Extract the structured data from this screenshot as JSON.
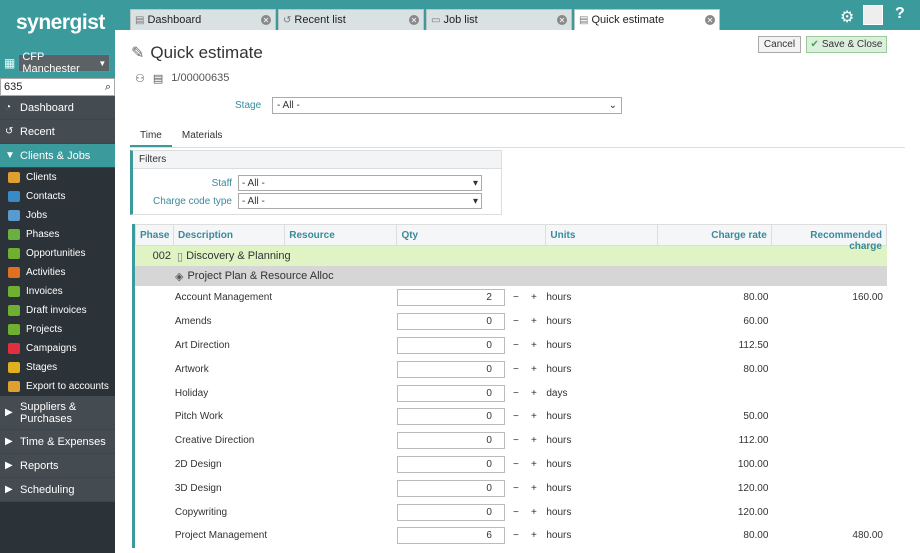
{
  "app": {
    "logo": "synergist",
    "company": "CFP Manchester",
    "search_value": "635"
  },
  "nav": {
    "main": [
      {
        "label": "Dashboard",
        "icon": "dashboard-icon"
      },
      {
        "label": "Recent",
        "icon": "recent-icon"
      },
      {
        "label": "Clients & Jobs",
        "icon": "expand-icon"
      }
    ],
    "sub": [
      {
        "label": "Clients",
        "color": "#e0a030"
      },
      {
        "label": "Contacts",
        "color": "#3a8ac8"
      },
      {
        "label": "Jobs",
        "color": "#5a9ad0"
      },
      {
        "label": "Phases",
        "color": "#6ab040"
      },
      {
        "label": "Opportunities",
        "color": "#70b030"
      },
      {
        "label": "Activities",
        "color": "#e07020"
      },
      {
        "label": "Invoices",
        "color": "#70b030"
      },
      {
        "label": "Draft invoices",
        "color": "#70b030"
      },
      {
        "label": "Projects",
        "color": "#70b030"
      },
      {
        "label": "Campaigns",
        "color": "#e03040"
      },
      {
        "label": "Stages",
        "color": "#e0b020"
      },
      {
        "label": "Export to accounts",
        "color": "#e0a030"
      }
    ],
    "bottom": [
      {
        "label": "Suppliers & Purchases"
      },
      {
        "label": "Time & Expenses"
      },
      {
        "label": "Reports"
      },
      {
        "label": "Scheduling"
      }
    ]
  },
  "tabs": [
    {
      "label": "Dashboard"
    },
    {
      "label": "Recent list"
    },
    {
      "label": "Job list"
    },
    {
      "label": "Quick estimate"
    }
  ],
  "page": {
    "title": "Quick estimate",
    "job_number": "1/00000635",
    "cancel": "Cancel",
    "save_close": "Save & Close",
    "stage_label": "Stage",
    "stage_value": "- All -"
  },
  "subtabs": [
    "Time",
    "Materials"
  ],
  "filters": {
    "title": "Filters",
    "staff_label": "Staff",
    "staff_value": "- All -",
    "charge_label": "Charge code type",
    "charge_value": "- All -"
  },
  "grid": {
    "headers": [
      "Phase",
      "Description",
      "Resource",
      "Qty",
      "Units",
      "Charge rate",
      "Recommended charge"
    ],
    "phase_code": "002",
    "phase_name": "Discovery & Planning",
    "subphase": "Project Plan & Resource Alloc",
    "rows": [
      {
        "desc": "Account Management",
        "qty": "2",
        "units": "hours",
        "rate": "80.00",
        "charge": "160.00"
      },
      {
        "desc": "Amends",
        "qty": "0",
        "units": "hours",
        "rate": "60.00",
        "charge": ""
      },
      {
        "desc": "Art Direction",
        "qty": "0",
        "units": "hours",
        "rate": "112.50",
        "charge": ""
      },
      {
        "desc": "Artwork",
        "qty": "0",
        "units": "hours",
        "rate": "80.00",
        "charge": ""
      },
      {
        "desc": "Holiday",
        "qty": "0",
        "units": "days",
        "rate": "",
        "charge": ""
      },
      {
        "desc": "Pitch Work",
        "qty": "0",
        "units": "hours",
        "rate": "50.00",
        "charge": ""
      },
      {
        "desc": "Creative Direction",
        "qty": "0",
        "units": "hours",
        "rate": "112.00",
        "charge": ""
      },
      {
        "desc": "2D Design",
        "qty": "0",
        "units": "hours",
        "rate": "100.00",
        "charge": ""
      },
      {
        "desc": "3D Design",
        "qty": "0",
        "units": "hours",
        "rate": "120.00",
        "charge": ""
      },
      {
        "desc": "Copywriting",
        "qty": "0",
        "units": "hours",
        "rate": "120.00",
        "charge": ""
      },
      {
        "desc": "Project Management",
        "qty": "6",
        "units": "hours",
        "rate": "80.00",
        "charge": "480.00"
      }
    ]
  }
}
